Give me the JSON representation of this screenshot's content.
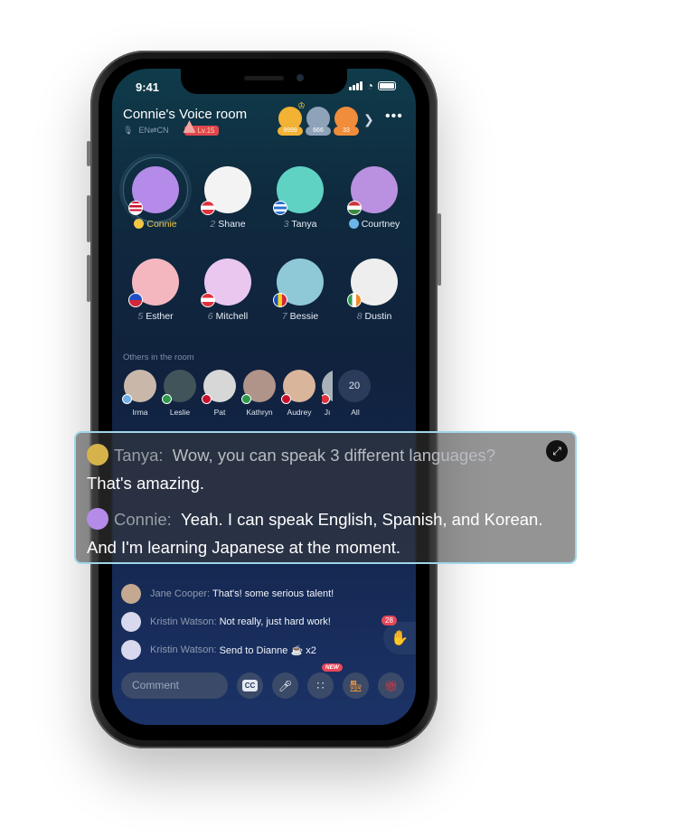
{
  "status_bar": {
    "time": "9:41"
  },
  "room": {
    "title": "Connie's Voice room",
    "language": "EN⇌CN",
    "level": "Lv.15",
    "top_contributors": [
      {
        "count": "9999",
        "color": "#f2b233"
      },
      {
        "count": "666",
        "color": "#8fa3b8"
      },
      {
        "count": "33",
        "color": "#f08c3a"
      }
    ]
  },
  "seats": [
    {
      "num": "",
      "name": "Connie",
      "host": true,
      "flag": "us",
      "bg": "#b48be8"
    },
    {
      "num": "2",
      "name": "Shane",
      "flag": "at",
      "bg": "#f3f3f3"
    },
    {
      "num": "3",
      "name": "Tanya",
      "flag": "gr",
      "bg": "#5fd2c4"
    },
    {
      "num": "",
      "name": "Courtney",
      "badge": true,
      "flag": "hu",
      "bg": "#b991e0"
    },
    {
      "num": "5",
      "name": "Esther",
      "flag": "ph",
      "bg": "#f4b7bf"
    },
    {
      "num": "6",
      "name": "Mitchell",
      "flag": "at",
      "bg": "#e9c7ee"
    },
    {
      "num": "7",
      "name": "Bessie",
      "flag": "ro",
      "bg": "#8fc9d8"
    },
    {
      "num": "8",
      "name": "Dustin",
      "flag": "ie",
      "bg": "#eeeeee"
    }
  ],
  "others": {
    "label": "Others in the room",
    "people": [
      {
        "name": "Irma",
        "bg": "#c9b7a9"
      },
      {
        "name": "Leslie",
        "bg": "#41545a"
      },
      {
        "name": "Pat",
        "bg": "#d7d7d7"
      },
      {
        "name": "Kathryn",
        "bg": "#b09489"
      },
      {
        "name": "Audrey",
        "bg": "#d9b59c"
      },
      {
        "name": "Jı",
        "bg": "#a8b2b8"
      }
    ],
    "all_count": "20",
    "all_label": "All"
  },
  "caption": {
    "lines": [
      {
        "speaker": "Tanya:",
        "text_dim": "Wow, you can speak 3 different languages?",
        "text": "That's amazing."
      },
      {
        "speaker": "Connie:",
        "text": "Yeah. I can speak English, Spanish, and Korean. And I'm learning Japanese at the moment."
      }
    ]
  },
  "chat": [
    {
      "who": "Jane Cooper:",
      "msg": "That's! some serious talent!"
    },
    {
      "who": "Kristin Watson:",
      "msg": "Not really, just hard work!"
    },
    {
      "who": "Kristin Watson:",
      "msg": "Send to Dianne ☕ x2"
    }
  ],
  "hand_raise_count": "28",
  "bottom_bar": {
    "comment_placeholder": "Comment",
    "cc_label": "CC",
    "new_badge": "NEW"
  }
}
